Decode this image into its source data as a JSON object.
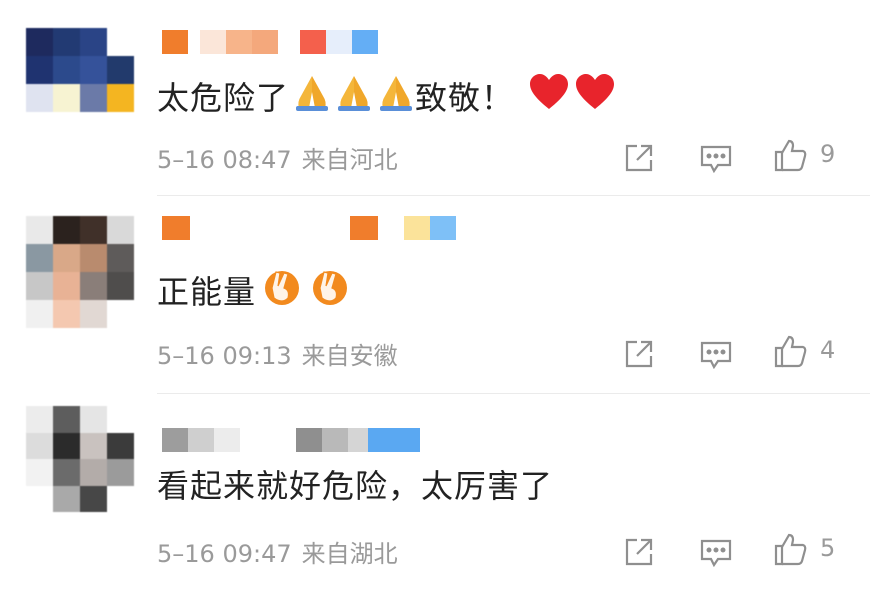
{
  "comments": [
    {
      "text": "太危险了",
      "text_suffix": "致敬！",
      "emojis_before": [
        "folded-hands",
        "folded-hands",
        "folded-hands"
      ],
      "emojis_after": [
        "red-heart",
        "red-heart"
      ],
      "date": "5–16 08:47",
      "location": "来自河北",
      "likes": "9"
    },
    {
      "text": "正能量",
      "emojis_after": [
        "victory-hand",
        "victory-hand"
      ],
      "date": "5–16 09:13",
      "location": "来自安徽",
      "likes": "4"
    },
    {
      "text": "看起来就好危险，太厉害了",
      "date": "5–16 09:47",
      "location": "来自湖北",
      "likes": "5"
    }
  ],
  "colors": {
    "meta_text": "#9a9a9a",
    "icon": "#8f8f8f",
    "divider": "#ebebeb"
  }
}
